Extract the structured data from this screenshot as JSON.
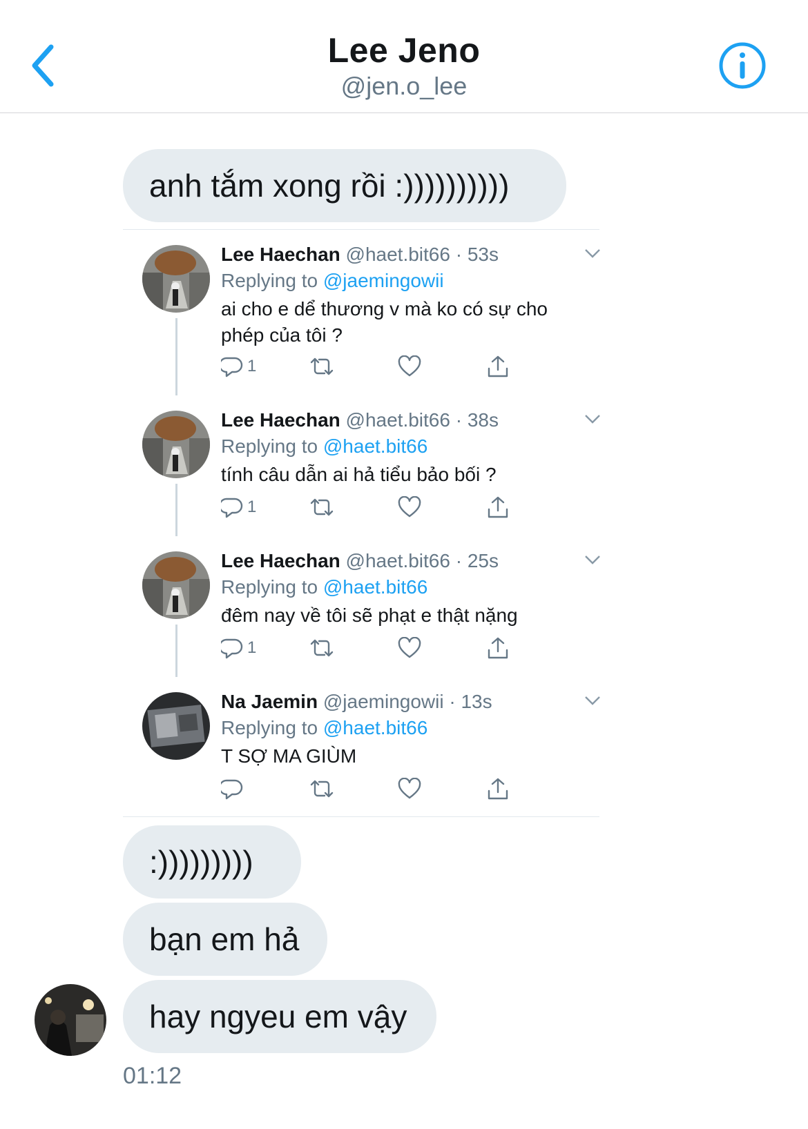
{
  "header": {
    "title": "Lee Jeno",
    "handle": "@jen.o_lee"
  },
  "messages": [
    {
      "text": "anh tắm xong rồi :))))))))))"
    },
    {
      "text": ":)))))))))"
    },
    {
      "text": "bạn em hả"
    },
    {
      "text": "hay ngyeu em vậy"
    }
  ],
  "timestamp": "01:12",
  "embedded_tweets": [
    {
      "name": "Lee Haechan",
      "handle": "@haet.bit66",
      "time": "· 53s",
      "replying_label": "Replying to",
      "replying_to": "@jaemingowii",
      "text": "ai cho e dể thương v mà ko có sự cho phép của tôi ?",
      "reply_count": "1"
    },
    {
      "name": "Lee Haechan",
      "handle": "@haet.bit66",
      "time": "· 38s",
      "replying_label": "Replying to",
      "replying_to": "@haet.bit66",
      "text": "tính câu dẫn ai hả tiểu bảo bối ?",
      "reply_count": "1"
    },
    {
      "name": "Lee Haechan",
      "handle": "@haet.bit66",
      "time": "· 25s",
      "replying_label": "Replying to",
      "replying_to": "@haet.bit66",
      "text": "đêm nay về tôi sẽ phạt e thật nặng",
      "reply_count": "1"
    },
    {
      "name": "Na Jaemin",
      "handle": "@jaemingowii",
      "time": "· 13s",
      "replying_label": "Replying to",
      "replying_to": "@haet.bit66",
      "text": "T SỢ MA GIÙM",
      "reply_count": ""
    }
  ],
  "icons": {
    "accent": "#1da1f2",
    "back": "chevron-left-icon",
    "info": "info-icon",
    "reply": "reply-icon",
    "retweet": "retweet-icon",
    "like": "heart-icon",
    "share": "share-icon"
  }
}
